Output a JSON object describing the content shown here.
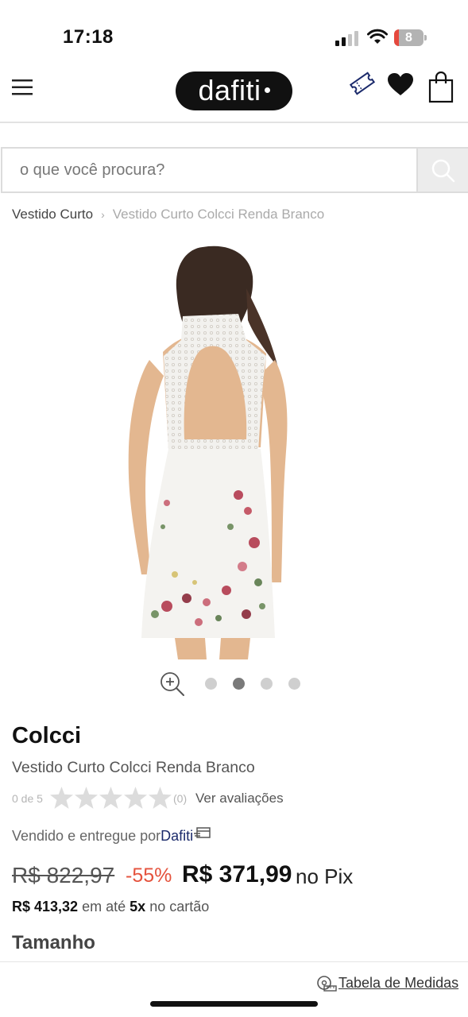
{
  "status_bar": {
    "time": "17:18",
    "battery_level": "8"
  },
  "header": {
    "logo_text": "dafiti"
  },
  "search": {
    "placeholder": "o que você procura?"
  },
  "breadcrumb": {
    "items": [
      "Vestido Curto",
      "Vestido Curto Colcci Renda Branco"
    ],
    "separator": "›"
  },
  "gallery": {
    "image_count": 4,
    "active_index": 1
  },
  "product": {
    "brand": "Colcci",
    "name": "Vestido Curto Colcci Renda Branco",
    "rating_label": "0 de 5",
    "rating_value": 0,
    "rating_max": 5,
    "review_count": "(0)",
    "see_reviews": "Ver avaliações",
    "seller_prefix": "Vendido e entregue por",
    "seller_name": "Dafiti",
    "old_price": "R$ 822,97",
    "discount": "-55%",
    "price": "R$ 371,99",
    "price_suffix": "no Pix",
    "installment_price": "R$ 413,32",
    "installment_middle": "em até",
    "installment_count": "5x",
    "installment_suffix": "no cartão",
    "size_heading": "Tamanho",
    "size_chart": "Tabela de Medidas"
  },
  "colors": {
    "discount": "#e5533d",
    "seller": "#1b2a6b",
    "logo_bg": "#111111"
  }
}
